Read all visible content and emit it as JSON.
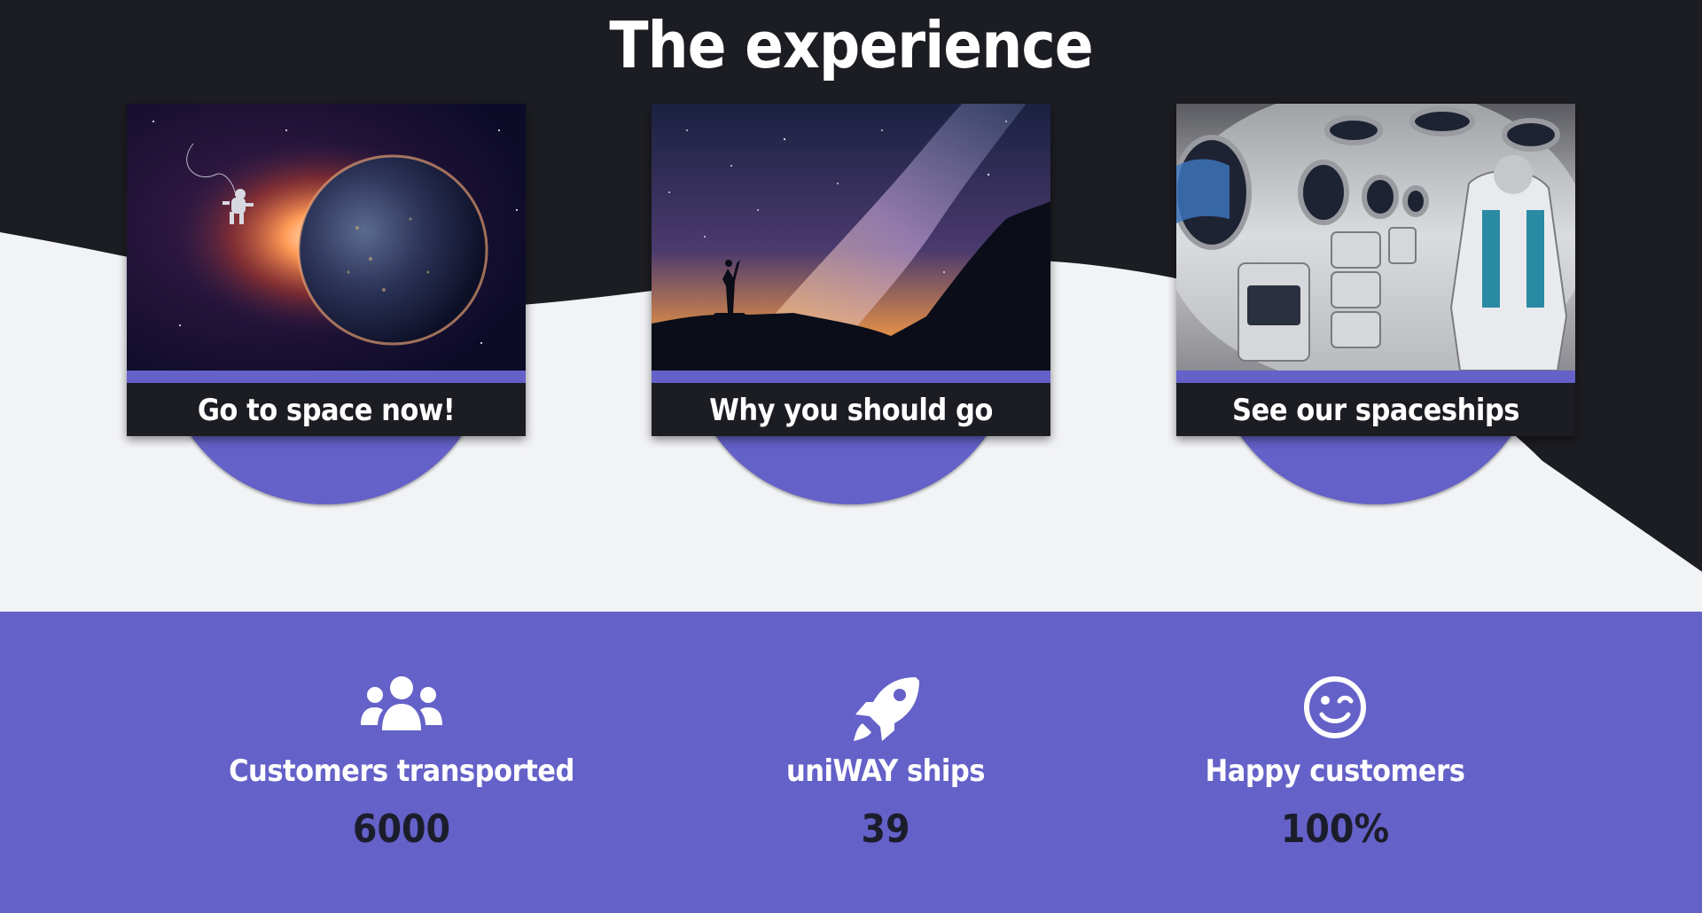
{
  "section": {
    "title": "The experience"
  },
  "cards": [
    {
      "label": "Go to space now!",
      "image": "earth-astronaut"
    },
    {
      "label": "Why you should go",
      "image": "milky-way-silhouette"
    },
    {
      "label": "See our spaceships",
      "image": "spaceship-cabin"
    }
  ],
  "stats": [
    {
      "icon": "users-icon",
      "label": "Customers transported",
      "value": "6000"
    },
    {
      "icon": "rocket-icon",
      "label": "uniWAY ships",
      "value": "39"
    },
    {
      "icon": "wink-smile-icon",
      "label": "Happy customers",
      "value": "100%"
    }
  ],
  "colors": {
    "dark": "#1c1d22",
    "accent": "#6461c8",
    "light": "#f2f3f5"
  }
}
